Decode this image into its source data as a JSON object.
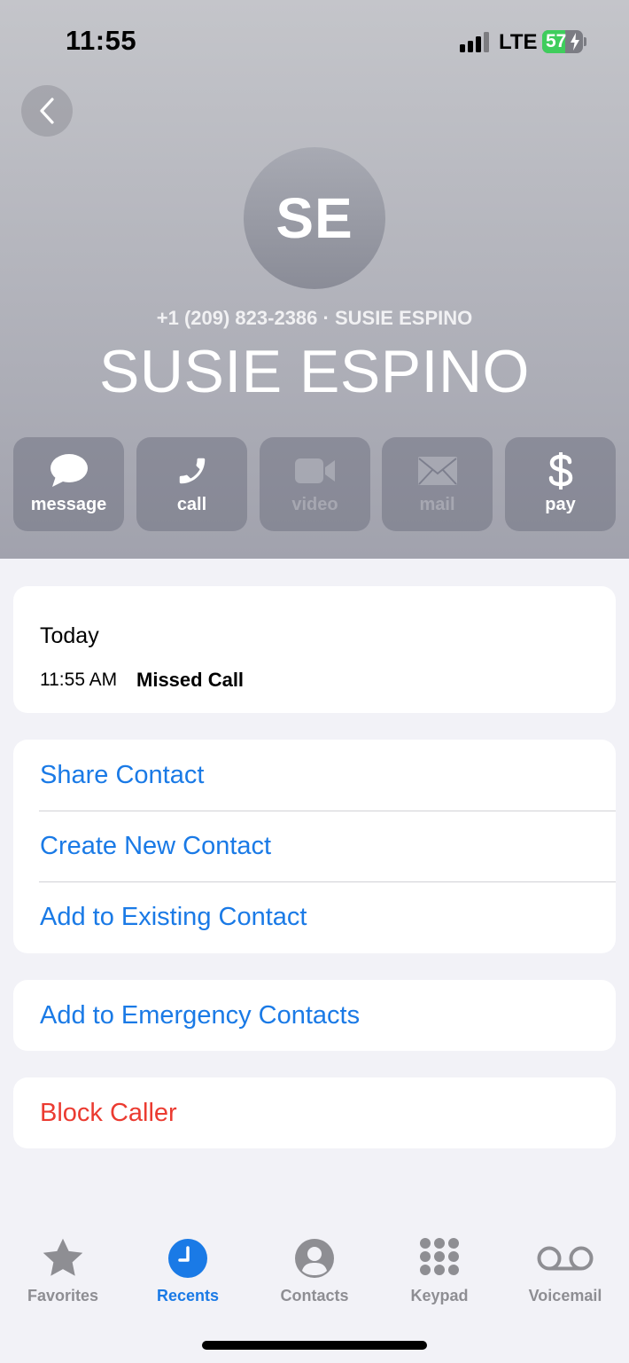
{
  "status_bar": {
    "time": "11:55",
    "network": "LTE",
    "battery_level": "57",
    "signal_bars_active": 3,
    "signal_bars_total": 4
  },
  "contact": {
    "initials": "SE",
    "subtitle": "+1 (209) 823-2386 · SUSIE ESPINO",
    "name": "SUSIE ESPINO"
  },
  "actions": [
    {
      "label": "message",
      "icon": "message-bubble-icon",
      "enabled": true
    },
    {
      "label": "call",
      "icon": "phone-icon",
      "enabled": true
    },
    {
      "label": "video",
      "icon": "video-camera-icon",
      "enabled": false
    },
    {
      "label": "mail",
      "icon": "envelope-icon",
      "enabled": false
    },
    {
      "label": "pay",
      "icon": "dollar-icon",
      "enabled": true
    }
  ],
  "recents": {
    "day": "Today",
    "time": "11:55 AM",
    "status": "Missed Call"
  },
  "options": {
    "share_contact": "Share Contact",
    "create_new_contact": "Create New Contact",
    "add_to_existing": "Add to Existing Contact",
    "add_to_emergency": "Add to Emergency Contacts",
    "block_caller": "Block Caller"
  },
  "tabs": [
    {
      "label": "Favorites",
      "icon": "star-icon",
      "active": false
    },
    {
      "label": "Recents",
      "icon": "clock-icon",
      "active": true
    },
    {
      "label": "Contacts",
      "icon": "person-circle-icon",
      "active": false
    },
    {
      "label": "Keypad",
      "icon": "keypad-icon",
      "active": false
    },
    {
      "label": "Voicemail",
      "icon": "voicemail-icon",
      "active": false
    }
  ],
  "colors": {
    "accent": "#1a7ae6",
    "destructive": "#eb3b31",
    "battery_charging": "#3fcd5c"
  }
}
